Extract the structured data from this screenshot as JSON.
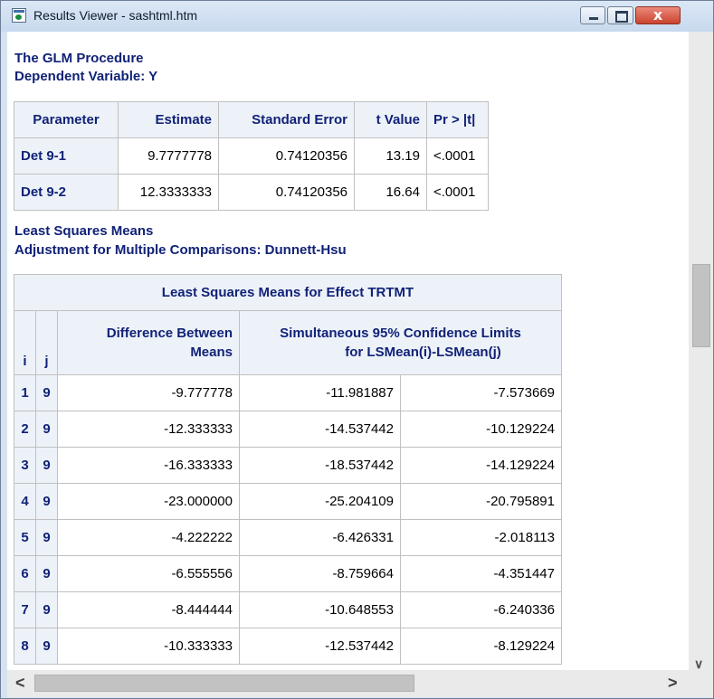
{
  "window": {
    "title": "Results Viewer - sashtml.htm",
    "close_glyph": "x"
  },
  "output": {
    "procedure_title": "The GLM Procedure",
    "dependent_variable": "Dependent Variable: Y",
    "parameter_table": {
      "headers": [
        "Parameter",
        "Estimate",
        "Standard Error",
        "t Value",
        "Pr > |t|"
      ],
      "rows": [
        {
          "parameter": "Det 9-1",
          "estimate": "9.7777778",
          "std_error": "0.74120356",
          "t_value": "13.19",
          "p_value": "<.0001"
        },
        {
          "parameter": "Det 9-2",
          "estimate": "12.3333333",
          "std_error": "0.74120356",
          "t_value": "16.64",
          "p_value": "<.0001"
        }
      ]
    },
    "ls_means_title": "Least Squares Means",
    "adjustment_title": "Adjustment for Multiple Comparisons: Dunnett-Hsu",
    "ls_table": {
      "title": "Least Squares Means for Effect TRTMT",
      "col_i": "i",
      "col_j": "j",
      "col_diff_line1": "Difference Between",
      "col_diff_line2": "Means",
      "col_ci_line1": "Simultaneous 95% Confidence Limits",
      "col_ci_line2": "for LSMean(i)-LSMean(j)",
      "rows": [
        {
          "i": "1",
          "j": "9",
          "diff": "-9.777778",
          "lower": "-11.981887",
          "upper": "-7.573669"
        },
        {
          "i": "2",
          "j": "9",
          "diff": "-12.333333",
          "lower": "-14.537442",
          "upper": "-10.129224"
        },
        {
          "i": "3",
          "j": "9",
          "diff": "-16.333333",
          "lower": "-18.537442",
          "upper": "-14.129224"
        },
        {
          "i": "4",
          "j": "9",
          "diff": "-23.000000",
          "lower": "-25.204109",
          "upper": "-20.795891"
        },
        {
          "i": "5",
          "j": "9",
          "diff": "-4.222222",
          "lower": "-6.426331",
          "upper": "-2.018113"
        },
        {
          "i": "6",
          "j": "9",
          "diff": "-6.555556",
          "lower": "-8.759664",
          "upper": "-4.351447"
        },
        {
          "i": "7",
          "j": "9",
          "diff": "-8.444444",
          "lower": "-10.648553",
          "upper": "-6.240336"
        },
        {
          "i": "8",
          "j": "9",
          "diff": "-10.333333",
          "lower": "-12.537442",
          "upper": "-8.129224"
        }
      ]
    }
  },
  "scrollbars": {
    "down_arrow": "∨",
    "left_arrow": "<",
    "right_arrow": ">"
  },
  "colors": {
    "heading": "#112277",
    "header_bg": "#edf2f9"
  }
}
